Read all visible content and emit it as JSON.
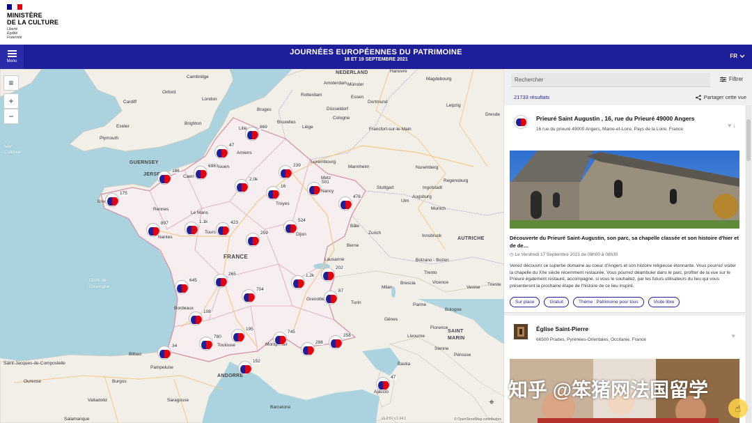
{
  "brand": {
    "name_line1": "MINISTÈRE",
    "name_line2": "DE LA CULTURE",
    "motto_1": "Liberté",
    "motto_2": "Égalité",
    "motto_3": "Fraternité",
    "flag_colors": [
      "#000091",
      "#ffffff",
      "#e1000f"
    ]
  },
  "header": {
    "menu_label": "Menu",
    "title": "JOURNÉES EUROPÉENNES DU PATRIMOINE",
    "subtitle": "18 ET 19 SEPTEMBRE 2021",
    "language": "FR",
    "bg_color": "#1e1e9a"
  },
  "map": {
    "controls": {
      "layers_icon": "layers-icon",
      "zoom_in": "+",
      "zoom_out": "−"
    },
    "version": "v1.2.0 / v.1.64.1",
    "attribution": "© OpenStreetMap contributors",
    "labels": {
      "cambridge": "Cambridge",
      "oxford": "Oxford",
      "cardiff": "Cardiff",
      "london": "London",
      "exeter": "Exeter",
      "plymouth": "Plymouth",
      "brighton": "Brighton",
      "mer": "Mer",
      "celtique": "Celtique",
      "guernsey": "GUERNSEY",
      "jersey": "JERSEY",
      "caen": "Caen",
      "rouen": "Rouen",
      "amiens": "Amiens",
      "brest": "Brest",
      "rennes": "Rennes",
      "le_mans": "Le Mans",
      "nantes": "Nantes",
      "tours": "Tours",
      "france": "FRANCE",
      "golfe": "Golfe de",
      "gascogne": "Gascogne",
      "bordeaux": "Bordeaux",
      "toulouse": "Toulouse",
      "montpellier": "Montpellier",
      "andorre": "ANDORRE",
      "bilbao": "Bilbao",
      "pampelune": "Pampelune",
      "santiago": "Saint-Jacques-de-Compostelle",
      "ourense": "Ourense",
      "burgos": "Burgos",
      "valladolid": "Valladolid",
      "saragosse": "Saragosse",
      "salamanque": "Salamanque",
      "barcelone": "Barcelone",
      "ajaccio": "Ajaccio",
      "bastia": "Bastia",
      "nederland": "NEDERLAND",
      "amsterdam": "Amsterdam",
      "rotterdam": "Rotterdam",
      "bruges": "Bruges",
      "bruxelles": "Bruxelles",
      "liege": "Liège",
      "cologne": "Cologne",
      "dusseldorf": "Düsseldorf",
      "essen": "Essen",
      "dortmund": "Dortmund",
      "hanovre": "Hanovre",
      "magdebourg": "Magdebourg",
      "leipzig": "Leipzig",
      "dresde": "Dresde",
      "munster": "Münster",
      "francfort": "Francfort-sur-le-Main",
      "mannheim": "Mannheim",
      "nuremberg": "Nuremberg",
      "stuttgart": "Stuttgart",
      "ingolstadt": "Ingolstadt",
      "regensburg": "Regensburg",
      "ulm": "Ulm",
      "munich": "Munich",
      "augsburg": "Augsburg",
      "luxembourg": "Luxembourg",
      "metz": "Metz",
      "nancy": "Nancy",
      "troyes": "Troyes",
      "dijon": "Dijon",
      "bale": "Bâle",
      "zurich": "Zurich",
      "berne": "Berne",
      "lausanne": "Lausanne",
      "innsbruck": "Innsbruck",
      "autriche": "AUTRICHE",
      "bolzano": "Bolzano - Bozen",
      "trento": "Trento",
      "vicence": "Vicence",
      "venise": "Venise",
      "brescia": "Brescia",
      "milan": "Milan",
      "turin": "Turin",
      "grenoble": "Grenoble",
      "genes": "Gênes",
      "parme": "Parme",
      "bologne": "Bologne",
      "florence": "Florence",
      "livourne": "Livourne",
      "sienne": "Sienne",
      "perouse": "Pérouse",
      "trieste": "Trieste",
      "saint_marin": "SAINT",
      "marin": "MARIN",
      "lille": "Lille"
    },
    "clusters": [
      {
        "id": "amiens",
        "count": "869"
      },
      {
        "id": "rouen",
        "count": "47"
      },
      {
        "id": "caen",
        "count": "698"
      },
      {
        "id": "jersey",
        "count": "186"
      },
      {
        "id": "lille2",
        "count": "239"
      },
      {
        "id": "paris",
        "count": "2.0k"
      },
      {
        "id": "reims",
        "count": "16"
      },
      {
        "id": "metz",
        "count": "501"
      },
      {
        "id": "strasbourg",
        "count": "476"
      },
      {
        "id": "brest",
        "count": "175"
      },
      {
        "id": "nantes",
        "count": "897"
      },
      {
        "id": "tours",
        "count": "1.1k"
      },
      {
        "id": "orleans",
        "count": "423"
      },
      {
        "id": "bourges",
        "count": "259"
      },
      {
        "id": "dijon",
        "count": "524"
      },
      {
        "id": "lyon",
        "count": "1.2k"
      },
      {
        "id": "annecy",
        "count": "202"
      },
      {
        "id": "grenoble",
        "count": "87"
      },
      {
        "id": "limoges",
        "count": "265"
      },
      {
        "id": "poitiers",
        "count": "645"
      },
      {
        "id": "clermont",
        "count": "704"
      },
      {
        "id": "bordeaux",
        "count": "108"
      },
      {
        "id": "toulouse",
        "count": "780"
      },
      {
        "id": "albi",
        "count": "195"
      },
      {
        "id": "montpellier",
        "count": "745"
      },
      {
        "id": "marseille",
        "count": "288"
      },
      {
        "id": "nice",
        "count": "258"
      },
      {
        "id": "pau",
        "count": "34"
      },
      {
        "id": "perpignan",
        "count": "152"
      },
      {
        "id": "corse",
        "count": "47"
      }
    ]
  },
  "panel": {
    "search_placeholder": "Rechercher",
    "filter_label": "Filtrer",
    "results": "21733 résultats",
    "share_label": "Partager cette vue",
    "cards": [
      {
        "title": "Prieuré Saint Augustin , 16, rue du Prieuré 49000 Angers",
        "address": "16 rue du prieuré 49000 Angers, Maine-et-Loire, Pays de la Loire, France",
        "likes": "1",
        "event_title": "Découverte du Prieuré Saint-Augustin, son parc, sa chapelle classée et son histoire d'hier et de de…",
        "event_date": "Le Vendredi 17 Septembre 2021 de 08h00 à 08h30",
        "event_desc": "Venez découvrir ce superbe domaine au coeur d'Angers et son histoire religieuse étonnante. Vous pourrez visiter la chapelle du XIIe siècle récemment restaurée. Vous pourrez déambuler dans le parc, profiter de la vue sur le Prieuré également restauré, accompagné, si vous le souhaitez, par les futurs utilisateurs du lieu qui vous présenteront la prochaine étape de l'histoire de ce lieu inspiré.",
        "tags": [
          "Sur place",
          "Gratuit",
          "Thème : Patrimoine pour tous",
          "Visite libre"
        ]
      },
      {
        "title": "Église Saint-Pierre",
        "address": "66500 Prades, Pyrénées-Orientales, Occitanie, France"
      }
    ]
  },
  "overlay": {
    "watermark": "知乎 @笨猪网法国留学"
  }
}
